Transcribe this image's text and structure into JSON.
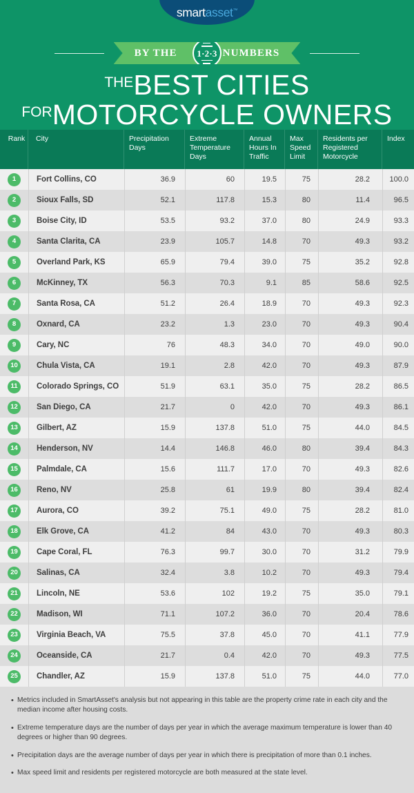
{
  "brand": {
    "logo_smart": "smart",
    "logo_asset": "asset",
    "logo_tm": "™"
  },
  "banner": {
    "left_text": "BY THE",
    "right_text": "NUMBERS",
    "emblem_text": "1·2·3"
  },
  "title": {
    "prefix1": "THE",
    "line1": "BEST CITIES",
    "prefix2": "FOR",
    "line2": "MOTORCYCLE OWNERS"
  },
  "colors": {
    "background_green": "#0e9467",
    "header_green": "#0a7a57",
    "ribbon_green": "#5fc067",
    "badge_green": "#4cbb68",
    "logo_navy": "#0b4d78",
    "logo_blue": "#4aa8dd",
    "row_odd": "#efefef",
    "row_even": "#dddddd",
    "notes_bg": "#dcdcdc"
  },
  "table": {
    "columns": [
      "Rank",
      "City",
      "Precipitation Days",
      "Extreme Temperature Days",
      "Annual Hours In Traffic",
      "Max Speed Limit",
      "Residents per Registered Motorcycle",
      "Index"
    ],
    "rows": [
      {
        "rank": "1",
        "city": "Fort Collins, CO",
        "precipitation_days": "36.9",
        "extreme_temp_days": "60",
        "annual_hours_traffic": "19.5",
        "max_speed_limit": "75",
        "residents_per_motorcycle": "28.2",
        "index": "100.0"
      },
      {
        "rank": "2",
        "city": "Sioux Falls, SD",
        "precipitation_days": "52.1",
        "extreme_temp_days": "117.8",
        "annual_hours_traffic": "15.3",
        "max_speed_limit": "80",
        "residents_per_motorcycle": "11.4",
        "index": "96.5"
      },
      {
        "rank": "3",
        "city": "Boise City, ID",
        "precipitation_days": "53.5",
        "extreme_temp_days": "93.2",
        "annual_hours_traffic": "37.0",
        "max_speed_limit": "80",
        "residents_per_motorcycle": "24.9",
        "index": "93.3"
      },
      {
        "rank": "4",
        "city": "Santa Clarita, CA",
        "precipitation_days": "23.9",
        "extreme_temp_days": "105.7",
        "annual_hours_traffic": "14.8",
        "max_speed_limit": "70",
        "residents_per_motorcycle": "49.3",
        "index": "93.2"
      },
      {
        "rank": "5",
        "city": "Overland Park, KS",
        "precipitation_days": "65.9",
        "extreme_temp_days": "79.4",
        "annual_hours_traffic": "39.0",
        "max_speed_limit": "75",
        "residents_per_motorcycle": "35.2",
        "index": "92.8"
      },
      {
        "rank": "6",
        "city": "McKinney, TX",
        "precipitation_days": "56.3",
        "extreme_temp_days": "70.3",
        "annual_hours_traffic": "9.1",
        "max_speed_limit": "85",
        "residents_per_motorcycle": "58.6",
        "index": "92.5"
      },
      {
        "rank": "7",
        "city": "Santa Rosa, CA",
        "precipitation_days": "51.2",
        "extreme_temp_days": "26.4",
        "annual_hours_traffic": "18.9",
        "max_speed_limit": "70",
        "residents_per_motorcycle": "49.3",
        "index": "92.3"
      },
      {
        "rank": "8",
        "city": "Oxnard, CA",
        "precipitation_days": "23.2",
        "extreme_temp_days": "1.3",
        "annual_hours_traffic": "23.0",
        "max_speed_limit": "70",
        "residents_per_motorcycle": "49.3",
        "index": "90.4"
      },
      {
        "rank": "9",
        "city": "Cary, NC",
        "precipitation_days": "76",
        "extreme_temp_days": "48.3",
        "annual_hours_traffic": "34.0",
        "max_speed_limit": "70",
        "residents_per_motorcycle": "49.0",
        "index": "90.0"
      },
      {
        "rank": "10",
        "city": "Chula Vista, CA",
        "precipitation_days": "19.1",
        "extreme_temp_days": "2.8",
        "annual_hours_traffic": "42.0",
        "max_speed_limit": "70",
        "residents_per_motorcycle": "49.3",
        "index": "87.9"
      },
      {
        "rank": "11",
        "city": "Colorado Springs, CO",
        "precipitation_days": "51.9",
        "extreme_temp_days": "63.1",
        "annual_hours_traffic": "35.0",
        "max_speed_limit": "75",
        "residents_per_motorcycle": "28.2",
        "index": "86.5"
      },
      {
        "rank": "12",
        "city": "San Diego, CA",
        "precipitation_days": "21.7",
        "extreme_temp_days": "0",
        "annual_hours_traffic": "42.0",
        "max_speed_limit": "70",
        "residents_per_motorcycle": "49.3",
        "index": "86.1"
      },
      {
        "rank": "13",
        "city": "Gilbert, AZ",
        "precipitation_days": "15.9",
        "extreme_temp_days": "137.8",
        "annual_hours_traffic": "51.0",
        "max_speed_limit": "75",
        "residents_per_motorcycle": "44.0",
        "index": "84.5"
      },
      {
        "rank": "14",
        "city": "Henderson, NV",
        "precipitation_days": "14.4",
        "extreme_temp_days": "146.8",
        "annual_hours_traffic": "46.0",
        "max_speed_limit": "80",
        "residents_per_motorcycle": "39.4",
        "index": "84.3"
      },
      {
        "rank": "15",
        "city": "Palmdale, CA",
        "precipitation_days": "15.6",
        "extreme_temp_days": "111.7",
        "annual_hours_traffic": "17.0",
        "max_speed_limit": "70",
        "residents_per_motorcycle": "49.3",
        "index": "82.6"
      },
      {
        "rank": "16",
        "city": "Reno, NV",
        "precipitation_days": "25.8",
        "extreme_temp_days": "61",
        "annual_hours_traffic": "19.9",
        "max_speed_limit": "80",
        "residents_per_motorcycle": "39.4",
        "index": "82.4"
      },
      {
        "rank": "17",
        "city": "Aurora, CO",
        "precipitation_days": "39.2",
        "extreme_temp_days": "75.1",
        "annual_hours_traffic": "49.0",
        "max_speed_limit": "75",
        "residents_per_motorcycle": "28.2",
        "index": "81.0"
      },
      {
        "rank": "18",
        "city": "Elk Grove, CA",
        "precipitation_days": "41.2",
        "extreme_temp_days": "84",
        "annual_hours_traffic": "43.0",
        "max_speed_limit": "70",
        "residents_per_motorcycle": "49.3",
        "index": "80.3"
      },
      {
        "rank": "19",
        "city": "Cape Coral, FL",
        "precipitation_days": "76.3",
        "extreme_temp_days": "99.7",
        "annual_hours_traffic": "30.0",
        "max_speed_limit": "70",
        "residents_per_motorcycle": "31.2",
        "index": "79.9"
      },
      {
        "rank": "20",
        "city": "Salinas, CA",
        "precipitation_days": "32.4",
        "extreme_temp_days": "3.8",
        "annual_hours_traffic": "10.2",
        "max_speed_limit": "70",
        "residents_per_motorcycle": "49.3",
        "index": "79.4"
      },
      {
        "rank": "21",
        "city": "Lincoln, NE",
        "precipitation_days": "53.6",
        "extreme_temp_days": "102",
        "annual_hours_traffic": "19.2",
        "max_speed_limit": "75",
        "residents_per_motorcycle": "35.0",
        "index": "79.1"
      },
      {
        "rank": "22",
        "city": "Madison, WI",
        "precipitation_days": "71.1",
        "extreme_temp_days": "107.2",
        "annual_hours_traffic": "36.0",
        "max_speed_limit": "70",
        "residents_per_motorcycle": "20.4",
        "index": "78.6"
      },
      {
        "rank": "23",
        "city": "Virginia Beach, VA",
        "precipitation_days": "75.5",
        "extreme_temp_days": "37.8",
        "annual_hours_traffic": "45.0",
        "max_speed_limit": "70",
        "residents_per_motorcycle": "41.1",
        "index": "77.9"
      },
      {
        "rank": "24",
        "city": "Oceanside, CA",
        "precipitation_days": "21.7",
        "extreme_temp_days": "0.4",
        "annual_hours_traffic": "42.0",
        "max_speed_limit": "70",
        "residents_per_motorcycle": "49.3",
        "index": "77.5"
      },
      {
        "rank": "25",
        "city": "Chandler, AZ",
        "precipitation_days": "15.9",
        "extreme_temp_days": "137.8",
        "annual_hours_traffic": "51.0",
        "max_speed_limit": "75",
        "residents_per_motorcycle": "44.0",
        "index": "77.0"
      }
    ]
  },
  "notes": [
    "Metrics included in SmartAsset's analysis but not appearing in this table are the property crime rate in each city and the median income after housing costs.",
    "Extreme temperature days are the number of days per year in which the average maximum temperature is lower than 40 degrees or higher than 90 degrees.",
    "Precipitation days are the average number of days per year in which there is precipitation of more than 0.1 inches.",
    "Max speed limit and residents per registered motorcycle are both measured at the state level."
  ]
}
